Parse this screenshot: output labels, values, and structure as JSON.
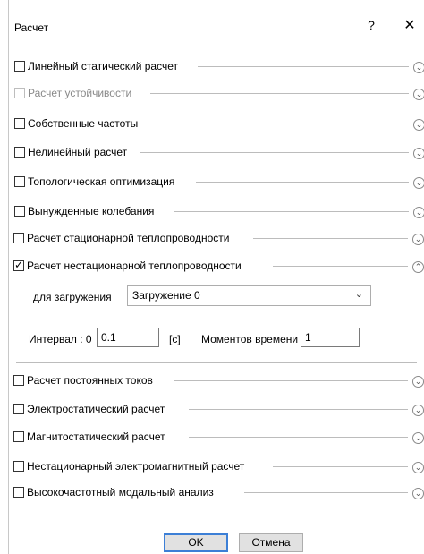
{
  "dialog": {
    "title": "Расчет",
    "help": "?",
    "close": "✕"
  },
  "options": [
    {
      "label": "Линейный статический расчет",
      "checked": false,
      "disabled": false,
      "expanded": false
    },
    {
      "label": "Расчет устойчивости",
      "checked": false,
      "disabled": true,
      "expanded": false
    },
    {
      "label": "Собственные частоты",
      "checked": false,
      "disabled": false,
      "expanded": false
    },
    {
      "label": "Нелинейный расчет",
      "checked": false,
      "disabled": false,
      "expanded": false
    },
    {
      "label": "Топологическая оптимизация",
      "checked": false,
      "disabled": false,
      "expanded": false
    },
    {
      "label": "Вынужденные колебания",
      "checked": false,
      "disabled": false,
      "expanded": false
    },
    {
      "label": "Расчет стационарной теплопроводности",
      "checked": false,
      "disabled": false,
      "expanded": false
    },
    {
      "label": "Расчет нестационарной теплопроводности",
      "checked": true,
      "disabled": false,
      "expanded": true
    },
    {
      "label": "Расчет постоянных токов",
      "checked": false,
      "disabled": false,
      "expanded": false
    },
    {
      "label": "Электростатический расчет",
      "checked": false,
      "disabled": false,
      "expanded": false
    },
    {
      "label": "Магнитостатический расчет",
      "checked": false,
      "disabled": false,
      "expanded": false
    },
    {
      "label": "Нестационарный электромагнитный расчет",
      "checked": false,
      "disabled": false,
      "expanded": false
    },
    {
      "label": "Высокочастотный модальный анализ",
      "checked": false,
      "disabled": false,
      "expanded": false
    }
  ],
  "transient": {
    "load_label": "для загружения",
    "load_value": "Загружение 0",
    "interval_label": "Интервал : 0",
    "interval_value": "0.1",
    "interval_unit": "[с]",
    "moments_label": "Моментов времени",
    "moments_value": "1"
  },
  "buttons": {
    "ok": "OK",
    "cancel": "Отмена"
  },
  "icons": {
    "chevron_down": "⌄",
    "chevron_up": "⌃",
    "check": "✓",
    "dropdown": "⌄"
  }
}
